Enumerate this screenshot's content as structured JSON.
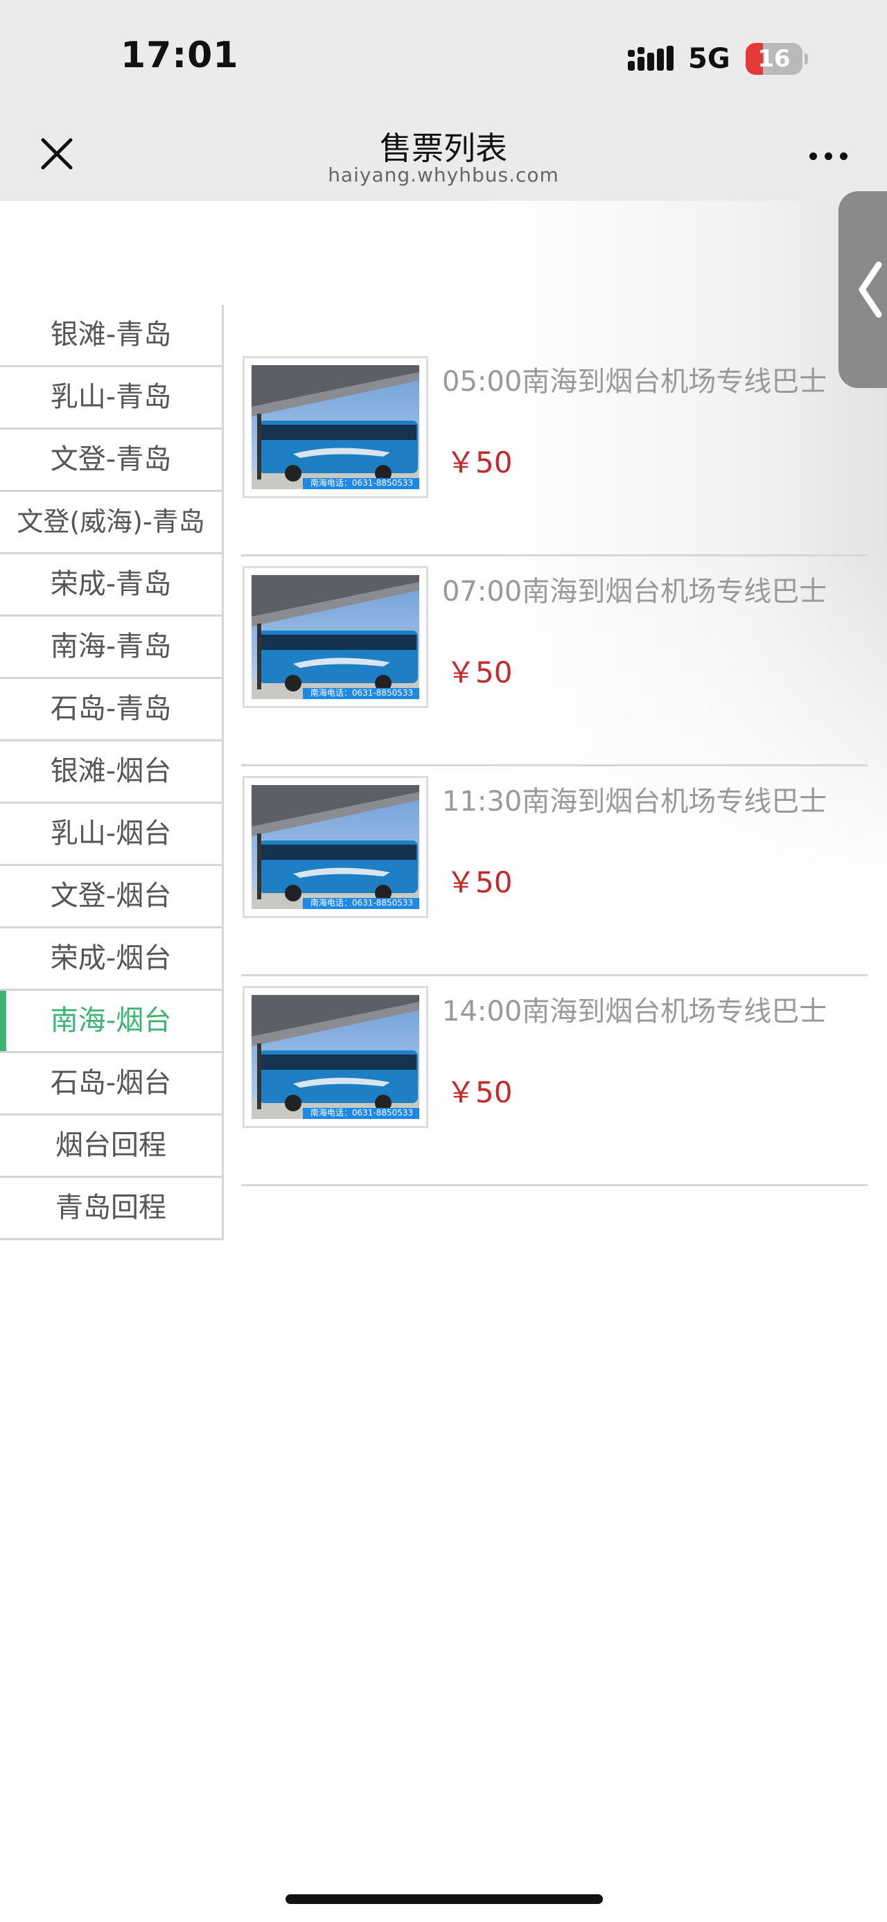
{
  "status_bar": {
    "time": "17:01",
    "network": "5G",
    "battery": "16",
    "battery_level_percent": 16
  },
  "nav": {
    "title": "售票列表",
    "subtitle": "haiyang.whyhbus.com",
    "close_icon": "close-icon",
    "more_icon": "more-icon"
  },
  "sidebar": {
    "items": [
      {
        "label": "银滩-青岛",
        "active": false
      },
      {
        "label": "乳山-青岛",
        "active": false
      },
      {
        "label": "文登-青岛",
        "active": false
      },
      {
        "label": "文登(威海)-青岛",
        "active": false
      },
      {
        "label": "荣成-青岛",
        "active": false
      },
      {
        "label": "南海-青岛",
        "active": false
      },
      {
        "label": "石岛-青岛",
        "active": false
      },
      {
        "label": "银滩-烟台",
        "active": false
      },
      {
        "label": "乳山-烟台",
        "active": false
      },
      {
        "label": "文登-烟台",
        "active": false
      },
      {
        "label": "荣成-烟台",
        "active": false
      },
      {
        "label": "南海-烟台",
        "active": true
      },
      {
        "label": "石岛-烟台",
        "active": false
      },
      {
        "label": "烟台回程",
        "active": false
      },
      {
        "label": "青岛回程",
        "active": false
      }
    ],
    "accent_color": "#3cb371"
  },
  "listings": [
    {
      "title": "05:00南海到烟台机场专线巴士",
      "price": "￥50",
      "image_caption": "南海电话：0631-8850533"
    },
    {
      "title": "07:00南海到烟台机场专线巴士",
      "price": "￥50",
      "image_caption": "南海电话：0631-8850533"
    },
    {
      "title": "11:30南海到烟台机场专线巴士",
      "price": "￥50",
      "image_caption": "南海电话：0631-8850533"
    },
    {
      "title": "14:00南海到烟台机场专线巴士",
      "price": "￥50",
      "image_caption": "南海电话：0631-8850533"
    }
  ],
  "side_tab": {
    "icon": "chevron-left-icon"
  },
  "colors": {
    "price": "#c62828",
    "title": "#999999",
    "header_bg": "#ebebeb"
  }
}
